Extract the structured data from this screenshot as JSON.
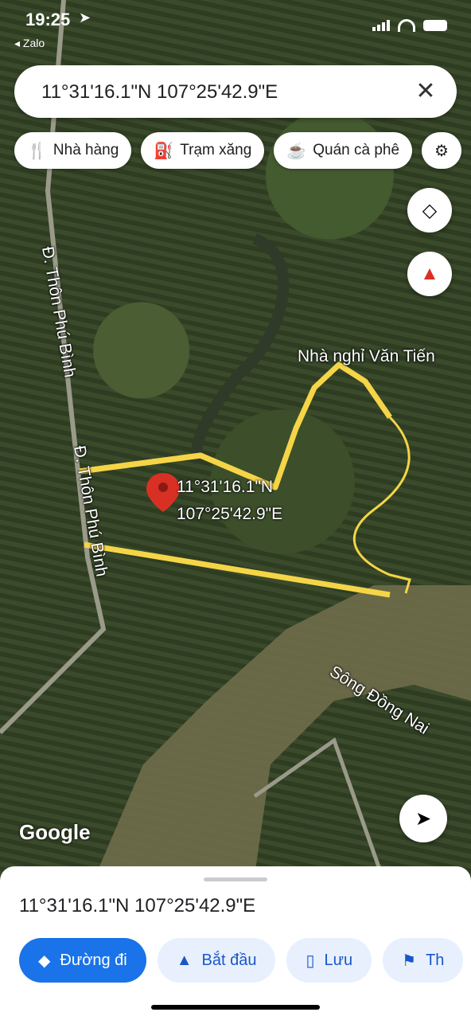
{
  "status": {
    "time": "19:25",
    "back_app": "◂ Zalo"
  },
  "search": {
    "query": "11°31'16.1\"N 107°25'42.9\"E"
  },
  "chips": [
    {
      "icon": "fork-knife-icon",
      "label": "Nhà hàng"
    },
    {
      "icon": "gas-station-icon",
      "label": "Trạm xăng"
    },
    {
      "icon": "coffee-cup-icon",
      "label": "Quán cà phê"
    }
  ],
  "map": {
    "road_label": "Đ. Thôn Phú Bình",
    "poi_label": "Nhà nghỉ Văn Tiến",
    "pin_label_line1": "11°31'16.1\"N",
    "pin_label_line2": "107°25'42.9\"E",
    "river_label": "Sông Đồng Nai",
    "attribution": "Google",
    "boundary_color": "#f5d547"
  },
  "sheet": {
    "title": "11°31'16.1\"N 107°25'42.9\"E",
    "actions": [
      "Đường đi",
      "Bắt đầu",
      "Lưu",
      "Th"
    ]
  }
}
